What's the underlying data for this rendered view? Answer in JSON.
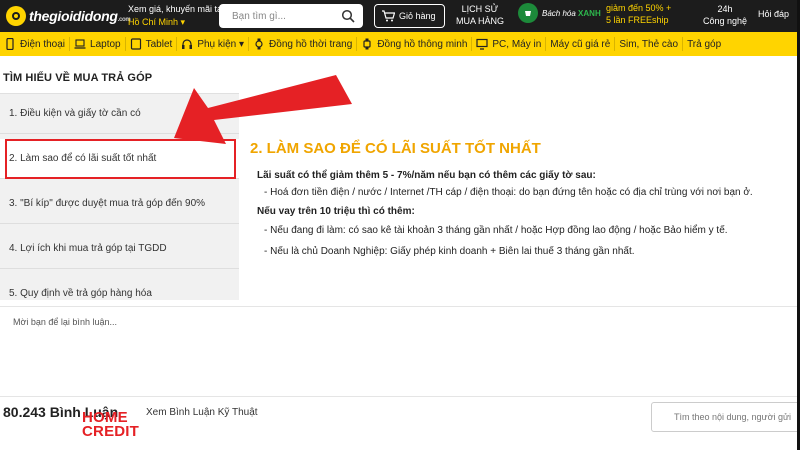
{
  "header": {
    "logo_text": "thegioididong",
    "logo_suffix": ".com",
    "promo_line1": "Xem giá, khuyến mãi tại",
    "location": "Hồ Chí Minh ▾",
    "search_placeholder": "Bạn tìm gì...",
    "cart_label": "Giỏ hàng",
    "history_line1": "LỊCH SỬ",
    "history_line2": "MUA HÀNG",
    "bhx_name_prefix": "Bách hóa",
    "bhx_name_brand": "XANH",
    "bhx_promo_line1": "giảm đến 50% +",
    "bhx_promo_line2": "5 lần FREEship",
    "tech24_line1": "24h",
    "tech24_line2": "Công nghệ",
    "qa_label": "Hỏi đáp"
  },
  "nav": {
    "items": [
      {
        "label": "Điện thoại",
        "icon": "phone-icon"
      },
      {
        "label": "Laptop",
        "icon": "laptop-icon"
      },
      {
        "label": "Tablet",
        "icon": "tablet-icon"
      },
      {
        "label": "Phụ kiện ▾",
        "icon": "headphone-icon"
      },
      {
        "label": "Đồng hồ thời trang",
        "icon": "watch-icon"
      },
      {
        "label": "Đồng hồ thông minh",
        "icon": "smartwatch-icon"
      },
      {
        "label": "PC, Máy in",
        "icon": "pc-icon"
      },
      {
        "label": "Máy cũ giá rẻ",
        "icon": ""
      },
      {
        "label": "Sim, Thẻ cào",
        "icon": ""
      },
      {
        "label": "Trả góp",
        "icon": ""
      }
    ]
  },
  "page": {
    "section_title": "TÌM HIỂU VỀ MUA TRẢ GÓP",
    "menu": [
      "1. Điều kiện và giấy tờ cần có",
      "2. Làm sao để có lãi suất tốt nhất",
      "3. \"Bí kíp\" được duyệt mua trả góp đến 90%",
      "4. Lợi ích khi mua trả góp tại TGDD",
      "5. Quy định về trả góp hàng hóa"
    ],
    "content_title": "2. LÀM SAO ĐỂ CÓ LÃI SUẤT TỐT NHẤT",
    "content_lines": {
      "intro": "Lãi suất có thể giảm thêm 5 - 7%/năm nếu bạn có thêm các giấy tờ sau:",
      "bullet1": "- Hoá đơn tiền điện / nước / Internet /TH cáp / điện thoại: do bạn đứng tên hoặc có địa chỉ trùng với nơi bạn ở.",
      "condition": "Nếu vay trên 10 triệu thì có thêm:",
      "bullet2": "- Nếu đang đi làm: có sao kê tài khoản 3 tháng gần nhất / hoặc Hợp đồng lao động / hoặc Bảo hiểm y tế.",
      "bullet3": "- Nếu là chủ Doanh Nghiệp: Giấy phép kinh doanh + Biên lai thuế 3 tháng gần nhất."
    },
    "comment_placeholder": "Mời bạn để lại bình luận...",
    "comment_count": "80.243 Bình Luận",
    "home_credit_line1": "HOME",
    "home_credit_line2": "CREDIT",
    "tech_comments": "Xem Bình Luận Kỹ Thuật",
    "search_comments_placeholder": "Tìm theo nội dung, người gửi"
  },
  "colors": {
    "header_bg": "#1c1c1c",
    "nav_bg": "#ffd400",
    "accent_orange": "#f0a500",
    "annotation_red": "#e52125",
    "menu_bg": "#f1f1f1"
  }
}
